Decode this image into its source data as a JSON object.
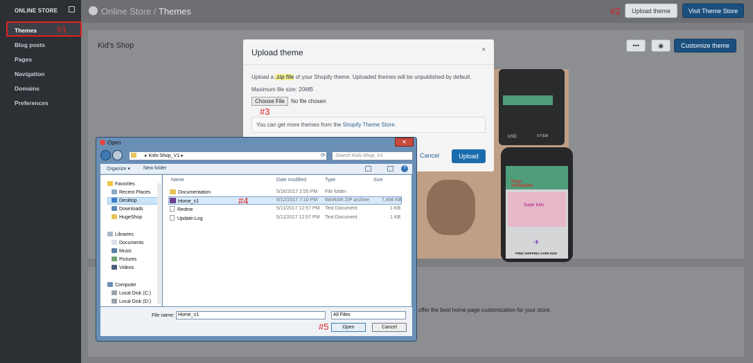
{
  "sidebar": {
    "header": "ONLINE STORE",
    "items": [
      {
        "label": "Themes"
      },
      {
        "label": "Blog posts"
      },
      {
        "label": "Pages"
      },
      {
        "label": "Navigation"
      },
      {
        "label": "Domains"
      },
      {
        "label": "Preferences"
      }
    ]
  },
  "header": {
    "crumb_parent": "Online Store",
    "crumb_sep": " / ",
    "crumb_current": "Themes",
    "upload_theme": "Upload theme",
    "visit_store": "Visit Theme Store"
  },
  "annotations": {
    "a1": "#1",
    "a2": "#2",
    "a3": "#3",
    "a4": "#4",
    "a5": "#5"
  },
  "card": {
    "title": "Kid's Shop",
    "dots_label": "•••",
    "eye_label": "◉",
    "customize": "Customize theme",
    "feature_text": "offer the best home page customization for your store."
  },
  "modal": {
    "title": "Upload theme",
    "close": "×",
    "desc_before": "Upload a ",
    "desc_zip": ".zip file",
    "desc_after": " of your Shopify theme. Uploaded themes will be unpublished by default.",
    "max_size": "Maximum file size: 20MB",
    "choose_file": "Choose File",
    "no_file": "No file chosen",
    "info_before": "You can get more themes from the ",
    "info_link": "Shopify Theme Store",
    "info_after": ".",
    "cancel": "Cancel",
    "upload": "Upload"
  },
  "dialog": {
    "title": "Open",
    "close": "✕",
    "path_root": "▸",
    "path_folder": "Kids-Shop_V1",
    "path_arrow": "▸",
    "search_placeholder": "Search Kids-Shop_V1",
    "organize": "Organize ▾",
    "new_folder": "New folder",
    "nav": {
      "favorites": "Favorites",
      "recent": "Recent Places",
      "desktop": "Desktop",
      "downloads": "Downloads",
      "hugeshop": "HugeShop",
      "libraries": "Libraries",
      "documents": "Documents",
      "music": "Music",
      "pictures": "Pictures",
      "videos": "Videos",
      "computer": "Computer",
      "disk_c": "Local Disk (C:)",
      "disk_d": "Local Disk (D:)"
    },
    "columns": {
      "name": "Name",
      "date": "Date modified",
      "type": "Type",
      "size": "Size"
    },
    "files": [
      {
        "name": "Documentation",
        "date": "5/16/2017 2:55 PM",
        "type": "File folder",
        "size": ""
      },
      {
        "name": "Home_v1",
        "date": "5/12/2017 7:10 PM",
        "type": "WinRAR ZIP archive",
        "size": "7,466 KB"
      },
      {
        "name": "Redme",
        "date": "5/11/2017 12:57 PM",
        "type": "Text Document",
        "size": "1 KB"
      },
      {
        "name": "Update-Log",
        "date": "5/11/2017 12:57 PM",
        "type": "Text Document",
        "size": "1 KB"
      }
    ],
    "file_name_label": "File name:",
    "file_name_value": "Home_v1",
    "filter": "All Files",
    "open": "Open",
    "cancel": "Cancel"
  },
  "preview": {
    "phone_brand": "Hugo Audiophile",
    "phone_banner": "Super Kids",
    "phone_shipping": "FREE SHIPPING OVER $150",
    "laptop_currency": "USD",
    "laptop_cart": "0 ITEM"
  }
}
